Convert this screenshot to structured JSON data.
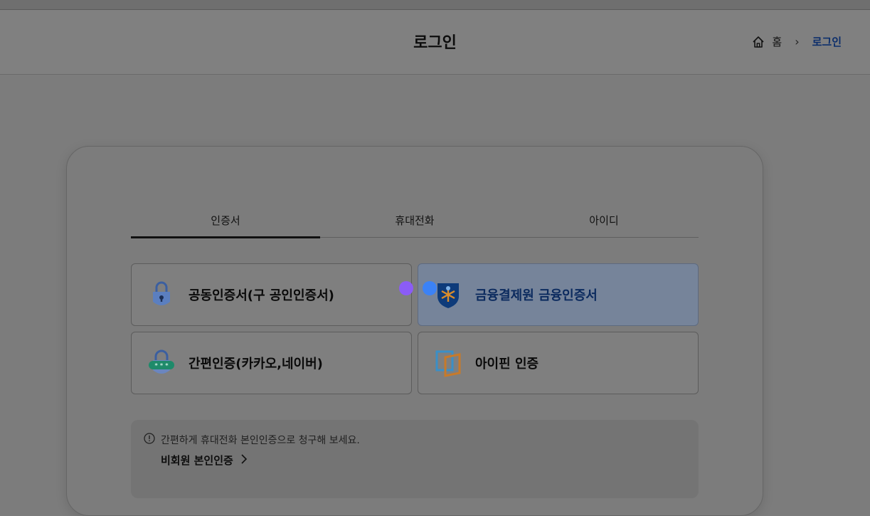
{
  "header": {
    "title": "로그인",
    "breadcrumb": {
      "home": "홈",
      "current": "로그인"
    }
  },
  "tabs": [
    {
      "label": "인증서",
      "active": true
    },
    {
      "label": "휴대전화",
      "active": false
    },
    {
      "label": "아이디",
      "active": false
    }
  ],
  "options": [
    {
      "label": "공동인증서(구 공인인증서)",
      "icon": "lock-icon",
      "selected": false
    },
    {
      "label": "금융결제원 금융인증서",
      "icon": "kftc-shield-icon",
      "selected": true
    },
    {
      "label": "간편인증(카카오,네이버)",
      "icon": "simple-auth-lock-icon",
      "selected": false
    },
    {
      "label": "아이핀 인증",
      "icon": "ipin-icon",
      "selected": false
    }
  ],
  "notice": {
    "text": "간편하게 휴대전화 본인인증으로 청구해 보세요.",
    "link": "비회원 본인인증"
  },
  "colors": {
    "accent": "#0c2e6b",
    "dot_purple": "#8b5cf6",
    "dot_blue": "#3b82f6"
  }
}
